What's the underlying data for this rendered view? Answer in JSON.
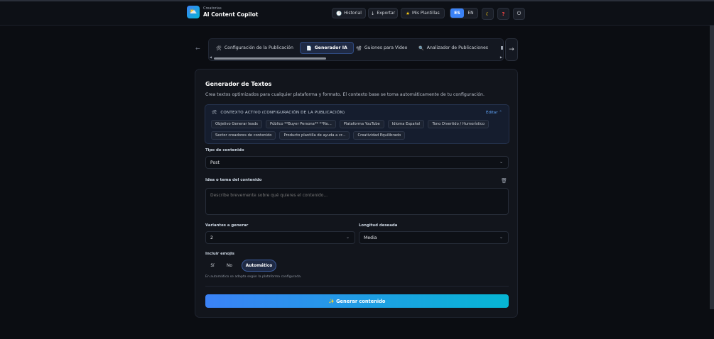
{
  "header": {
    "brand_small": "Creatorias",
    "brand_title": "AI Content Copilot",
    "history": "Historial",
    "export": "Exportar",
    "templates": "Mis Plantillas",
    "lang_es": "ES",
    "lang_en": "EN"
  },
  "tabs": [
    {
      "label": "Configuración de la Publicación",
      "icon": "🛠"
    },
    {
      "label": "Generador IA",
      "icon": "📄"
    },
    {
      "label": "Guiones para Video",
      "icon": "📽"
    },
    {
      "label": "Analizador de Publicaciones",
      "icon": "🔍"
    }
  ],
  "card": {
    "title": "Generador de Textos",
    "description": "Crea textos optimizados para cualquier plataforma y formato. El contexto base se toma automáticamente de tu configuración."
  },
  "context": {
    "heading": "CONTEXTO ACTIVO (CONFIGURACIÓN DE LA PUBLICACIÓN)",
    "edit": "Editar ⌃",
    "chips_row1": [
      "Objetivo Generar leads",
      "Público **Buyer Persona** **No...",
      "Plataforma YouTube",
      "Idioma Español",
      "Tono Divertido / Humorístico"
    ],
    "chips_row2": [
      "Sector creadores de contenido",
      "Producto plantilla de ayuda a cr...",
      "Creatividad Equilibrado"
    ]
  },
  "form": {
    "type_label": "Tipo de contenido",
    "type_value": "Post",
    "idea_label": "Idea o tema del contenido",
    "idea_placeholder": "Describe brevemente sobre qué quieres el contenido...",
    "variants_label": "Variantes a generar",
    "variants_value": "2",
    "length_label": "Longitud deseada",
    "length_value": "Media",
    "emoji_label": "Incluir emojis",
    "emoji_options": [
      "Sí",
      "No",
      "Automático"
    ],
    "emoji_hint": "En automático se adapta según la plataforma configurada.",
    "generate": "✨ Generar contenido"
  }
}
